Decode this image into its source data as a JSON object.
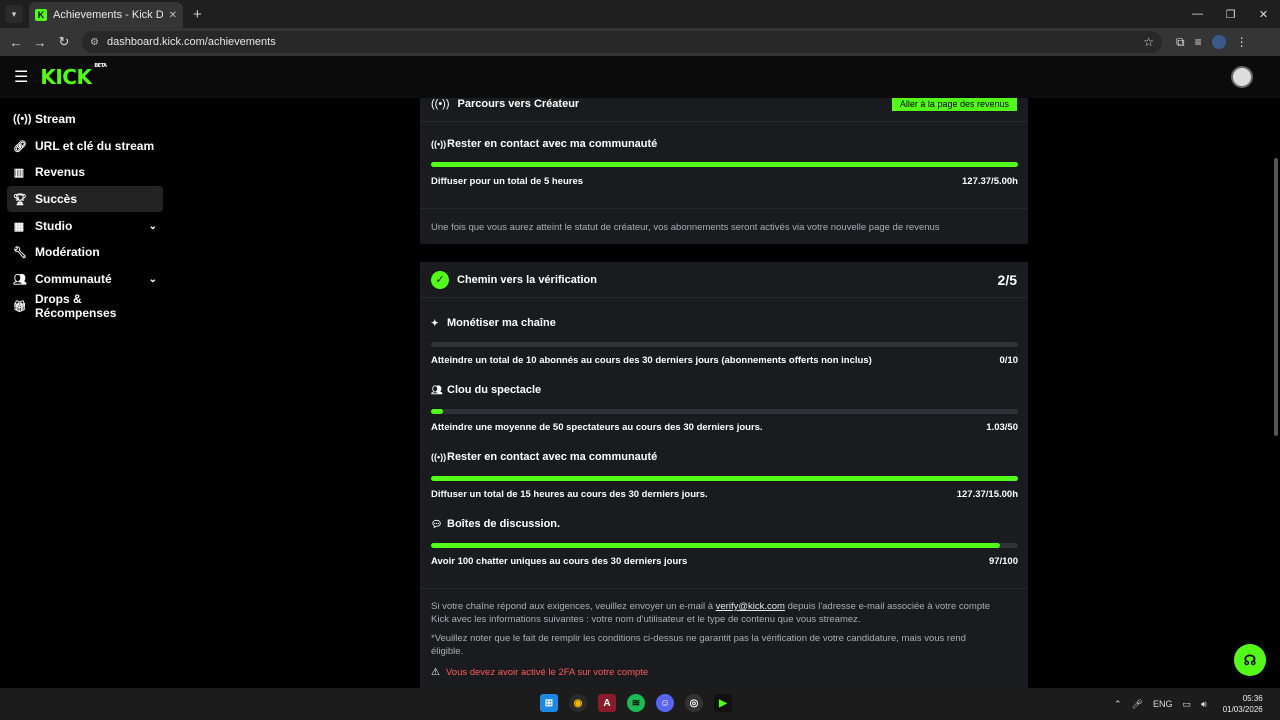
{
  "browser": {
    "tab_title": "Achievements - Kick Dashboard",
    "url": "dashboard.kick.com/achievements"
  },
  "site": {
    "logo": "KICK",
    "logo_badge": "BETA"
  },
  "sidebar": {
    "items": [
      {
        "label": "Stream",
        "icon": "broadcast-icon"
      },
      {
        "label": "URL et clé du stream",
        "icon": "link-icon"
      },
      {
        "label": "Revenus",
        "icon": "chart-icon"
      },
      {
        "label": "Succès",
        "icon": "trophy-icon",
        "active": true
      },
      {
        "label": "Studio",
        "icon": "film-icon",
        "expandable": true
      },
      {
        "label": "Modération",
        "icon": "wrench-icon"
      },
      {
        "label": "Communauté",
        "icon": "users-icon",
        "expandable": true
      },
      {
        "label": "Drops & Récompenses",
        "icon": "gift-icon"
      }
    ]
  },
  "creator_card": {
    "title": "Parcours vers Créateur",
    "button": "Aller à la page des revenus",
    "task": {
      "title": "Rester en contact avec ma communauté",
      "description": "Diffuser pour un total de 5 heures",
      "value": "127.37/5.00h",
      "progress": 1.0
    },
    "note": "Une fois que vous aurez atteint le statut de créateur, vos abonnements seront activés via votre nouvelle page de revenus"
  },
  "verification_card": {
    "title": "Chemin vers la vérification",
    "count": "2/5",
    "tasks": [
      {
        "title": "Monétiser ma chaîne",
        "icon": "sparkle-icon",
        "description": "Atteindre un total de 10 abonnés au cours des 30 derniers jours (abonnements offerts non inclus)",
        "value": "0/10",
        "progress": 0.0
      },
      {
        "title": "Clou du spectacle",
        "icon": "users-icon",
        "description": "Atteindre une moyenne de 50 spectateurs au cours des 30 derniers jours.",
        "value": "1.03/50",
        "progress": 0.02
      },
      {
        "title": "Rester en contact avec ma communauté",
        "icon": "broadcast-icon",
        "description": "Diffuser un total de 15 heures au cours des 30 derniers jours.",
        "value": "127.37/15.00h",
        "progress": 1.0
      },
      {
        "title": "Boîtes de discussion.",
        "icon": "chat-icon",
        "description": "Avoir 100 chatter uniques au cours des 30 derniers jours",
        "value": "97/100",
        "progress": 0.97
      }
    ],
    "note_before_link": "Si votre chaîne répond aux exigences, veuillez envoyer un e-mail à",
    "note_link": "verify@kick.com",
    "note_after_link": "depuis l'adresse e-mail associée à votre compte",
    "note_line2": "Kick avec les informations suivantes : votre nom d'utilisateur et le type de contenu que vous streamez.",
    "disclaimer_line1": "*Veuillez noter que le fait de remplir les conditions ci-dessus ne garantit pas la vérification de votre candidature, mais vous rend",
    "disclaimer_line2": "éligible.",
    "warning": "Vous devez avoir activé le 2FA sur votre compte"
  },
  "taskbar": {
    "language": "ENG",
    "time": "05:36",
    "date": "01/03/2026"
  }
}
